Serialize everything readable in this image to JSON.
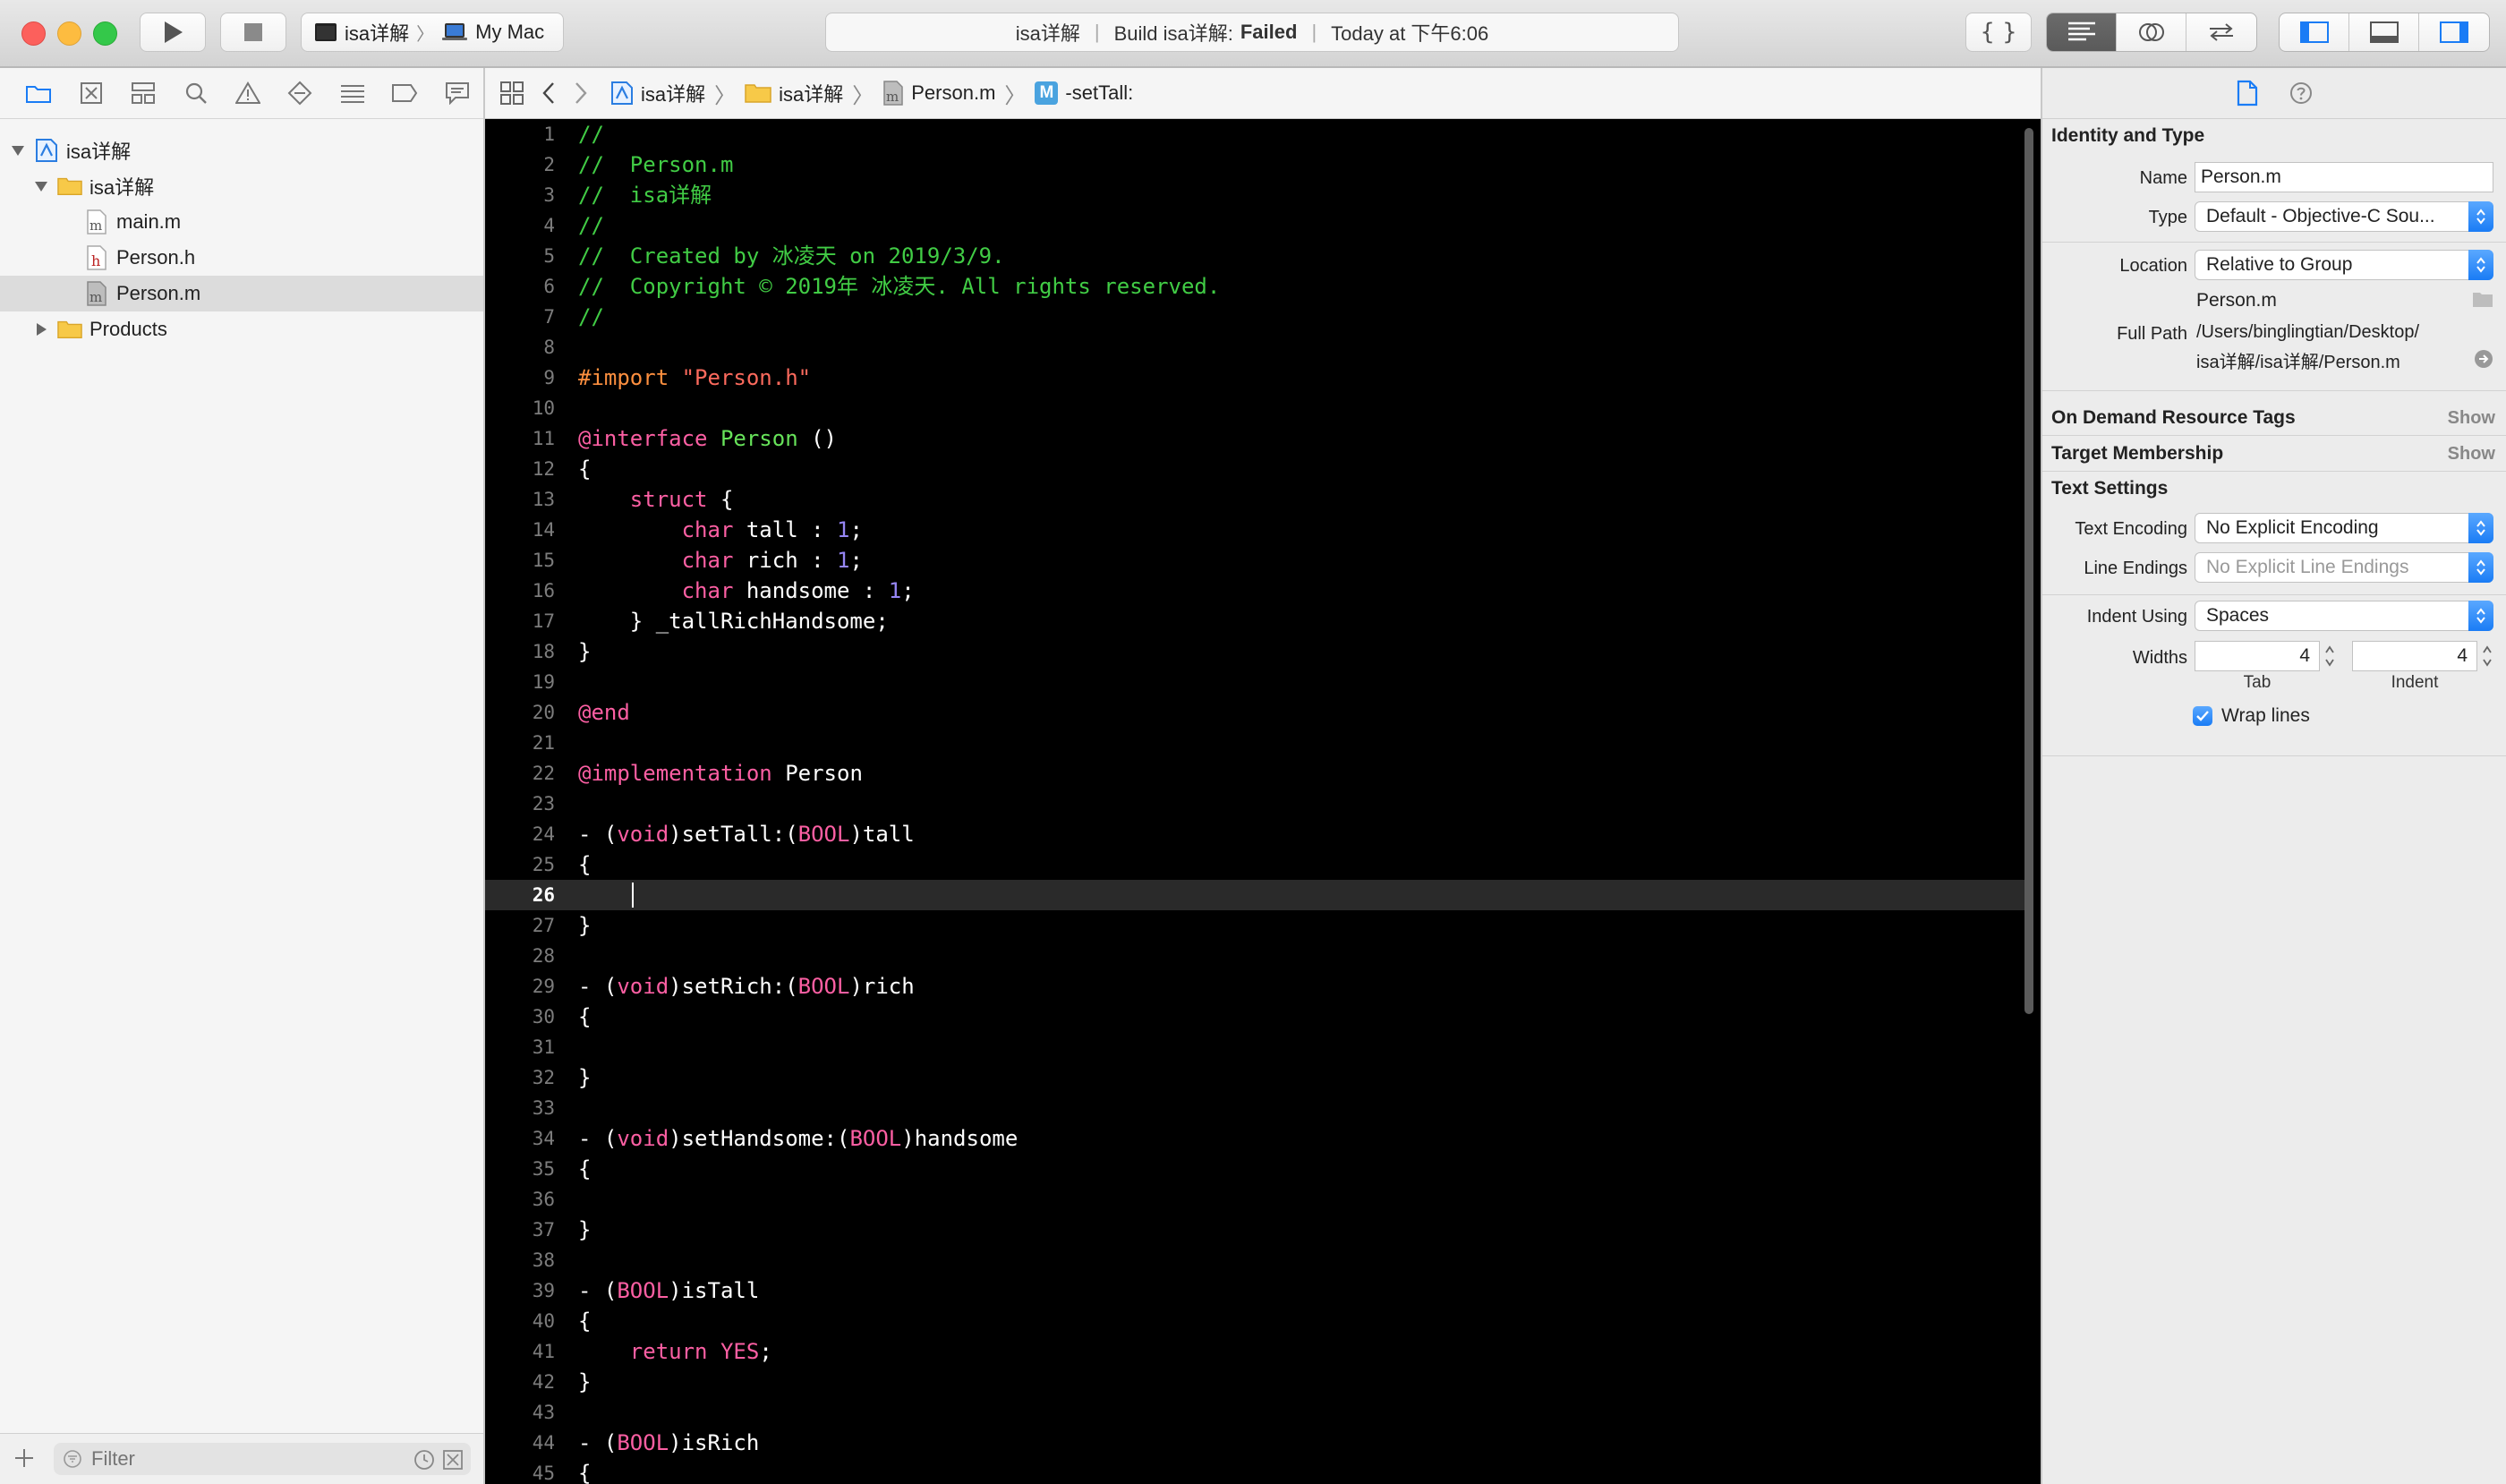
{
  "window": {
    "scheme_target": "isa详解",
    "scheme_device": "My Mac",
    "activity": {
      "project": "isa详解",
      "status_prefix": "Build isa详解:",
      "status": "Failed",
      "time": "Today at 下午6:06"
    }
  },
  "navigator": {
    "items": [
      {
        "label": "isa详解",
        "kind": "project"
      },
      {
        "label": "isa详解",
        "kind": "folder"
      },
      {
        "label": "main.m",
        "kind": "m-file"
      },
      {
        "label": "Person.h",
        "kind": "h-file"
      },
      {
        "label": "Person.m",
        "kind": "m-file",
        "selected": true
      },
      {
        "label": "Products",
        "kind": "folder"
      }
    ],
    "filter_placeholder": "Filter"
  },
  "jumpbar": {
    "crumbs": [
      "isa详解",
      "isa详解",
      "Person.m",
      "-setTall:"
    ],
    "method_badge": "M"
  },
  "editor": {
    "current_line": 26,
    "colors": {
      "comment": "#41cc45",
      "keyword": "#fc5fa3",
      "string": "#fc6a5d",
      "preprocessor": "#fd8f3f",
      "type": "#67e35a",
      "number": "#9686f5",
      "plain": "#ffffff"
    },
    "lines": [
      [
        [
          "c",
          "//"
        ]
      ],
      [
        [
          "c",
          "//  Person.m"
        ]
      ],
      [
        [
          "c",
          "//  isa详解"
        ]
      ],
      [
        [
          "c",
          "//"
        ]
      ],
      [
        [
          "c",
          "//  Created by 冰凌天 on 2019/3/9."
        ]
      ],
      [
        [
          "c",
          "//  Copyright © 2019年 冰凌天. All rights reserved."
        ]
      ],
      [
        [
          "c",
          "//"
        ]
      ],
      [],
      [
        [
          "pp",
          "#import "
        ],
        [
          "s",
          "\"Person.h\""
        ]
      ],
      [],
      [
        [
          "k",
          "@interface"
        ],
        [
          "p",
          " "
        ],
        [
          "t",
          "Person"
        ],
        [
          "p",
          " ()"
        ]
      ],
      [
        [
          "p",
          "{"
        ]
      ],
      [
        [
          "p",
          "    "
        ],
        [
          "k",
          "struct"
        ],
        [
          "p",
          " {"
        ]
      ],
      [
        [
          "p",
          "        "
        ],
        [
          "k",
          "char"
        ],
        [
          "p",
          " tall : "
        ],
        [
          "n",
          "1"
        ],
        [
          "p",
          ";"
        ]
      ],
      [
        [
          "p",
          "        "
        ],
        [
          "k",
          "char"
        ],
        [
          "p",
          " rich : "
        ],
        [
          "n",
          "1"
        ],
        [
          "p",
          ";"
        ]
      ],
      [
        [
          "p",
          "        "
        ],
        [
          "k",
          "char"
        ],
        [
          "p",
          " handsome : "
        ],
        [
          "n",
          "1"
        ],
        [
          "p",
          ";"
        ]
      ],
      [
        [
          "p",
          "    } _tallRichHandsome;"
        ]
      ],
      [
        [
          "p",
          "}"
        ]
      ],
      [],
      [
        [
          "k",
          "@end"
        ]
      ],
      [],
      [
        [
          "k",
          "@implementation"
        ],
        [
          "p",
          " Person"
        ]
      ],
      [],
      [
        [
          "p",
          "- ("
        ],
        [
          "k",
          "void"
        ],
        [
          "p",
          ")setTall:("
        ],
        [
          "k",
          "BOOL"
        ],
        [
          "p",
          ")tall"
        ]
      ],
      [
        [
          "p",
          "{"
        ]
      ],
      [
        [
          "p",
          "    "
        ]
      ],
      [
        [
          "p",
          "}"
        ]
      ],
      [],
      [
        [
          "p",
          "- ("
        ],
        [
          "k",
          "void"
        ],
        [
          "p",
          ")setRich:("
        ],
        [
          "k",
          "BOOL"
        ],
        [
          "p",
          ")rich"
        ]
      ],
      [
        [
          "p",
          "{"
        ]
      ],
      [],
      [
        [
          "p",
          "}"
        ]
      ],
      [],
      [
        [
          "p",
          "- ("
        ],
        [
          "k",
          "void"
        ],
        [
          "p",
          ")setHandsome:("
        ],
        [
          "k",
          "BOOL"
        ],
        [
          "p",
          ")handsome"
        ]
      ],
      [
        [
          "p",
          "{"
        ]
      ],
      [],
      [
        [
          "p",
          "}"
        ]
      ],
      [],
      [
        [
          "p",
          "- ("
        ],
        [
          "k",
          "BOOL"
        ],
        [
          "p",
          ")isTall"
        ]
      ],
      [
        [
          "p",
          "{"
        ]
      ],
      [
        [
          "p",
          "    "
        ],
        [
          "k",
          "return"
        ],
        [
          "p",
          " "
        ],
        [
          "k",
          "YES"
        ],
        [
          "p",
          ";"
        ]
      ],
      [
        [
          "p",
          "}"
        ]
      ],
      [],
      [
        [
          "p",
          "- ("
        ],
        [
          "k",
          "BOOL"
        ],
        [
          "p",
          ")isRich"
        ]
      ],
      [
        [
          "p",
          "{"
        ]
      ]
    ]
  },
  "inspector": {
    "identity_title": "Identity and Type",
    "name_label": "Name",
    "name_value": "Person.m",
    "type_label": "Type",
    "type_value": "Default - Objective-C Sou...",
    "location_label": "Location",
    "location_value": "Relative to Group",
    "location_file": "Person.m",
    "fullpath_label": "Full Path",
    "fullpath_line1": "/Users/binglingtian/Desktop/",
    "fullpath_line2": "isa详解/isa详解/Person.m",
    "ondemand_title": "On Demand Resource Tags",
    "target_title": "Target Membership",
    "show_label": "Show",
    "text_settings_title": "Text Settings",
    "encoding_label": "Text Encoding",
    "encoding_value": "No Explicit Encoding",
    "line_endings_label": "Line Endings",
    "line_endings_value": "No Explicit Line Endings",
    "indent_using_label": "Indent Using",
    "indent_using_value": "Spaces",
    "widths_label": "Widths",
    "tab_width": "4",
    "indent_width": "4",
    "tab_label": "Tab",
    "indent_label": "Indent",
    "wrap_label": "Wrap lines",
    "wrap_checked": true
  }
}
